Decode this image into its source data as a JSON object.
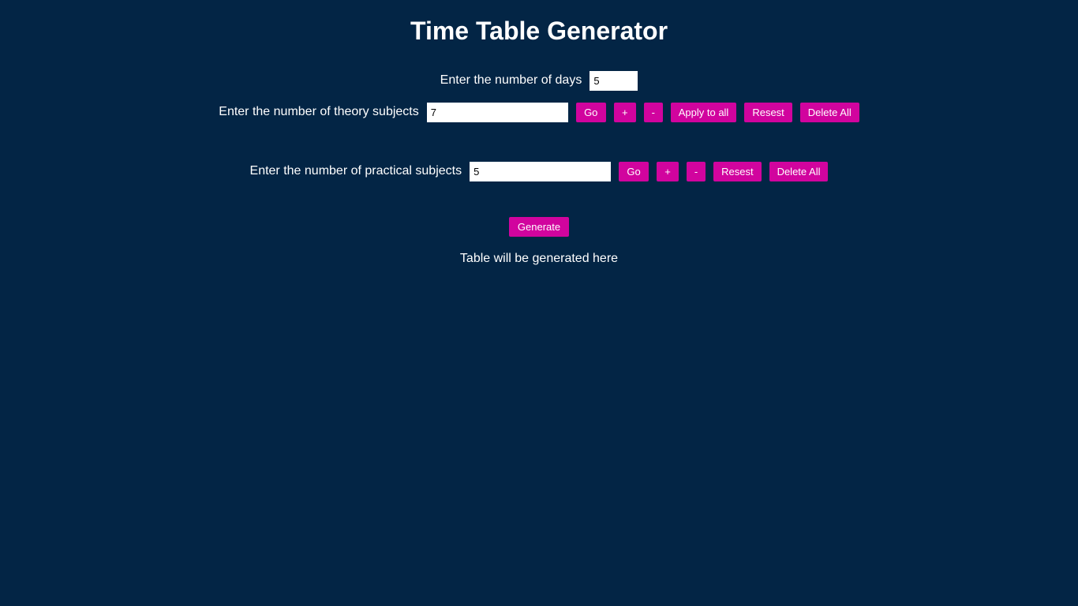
{
  "title": "Time Table Generator",
  "days": {
    "label": "Enter the number of days",
    "value": "5"
  },
  "theory": {
    "label": "Enter the number of theory subjects",
    "value": "7",
    "go_label": "Go",
    "plus_label": "+",
    "minus_label": "-",
    "apply_all_label": "Apply to all",
    "reset_label": "Resest",
    "delete_all_label": "Delete All"
  },
  "practical": {
    "label": "Enter the number of practical subjects",
    "value": "5",
    "go_label": "Go",
    "plus_label": "+",
    "minus_label": "-",
    "reset_label": "Resest",
    "delete_all_label": "Delete All"
  },
  "generate_label": "Generate",
  "result_text": "Table will be generated here",
  "colors": {
    "background": "#032545",
    "button": "#d1049e",
    "text": "#ffffff"
  }
}
